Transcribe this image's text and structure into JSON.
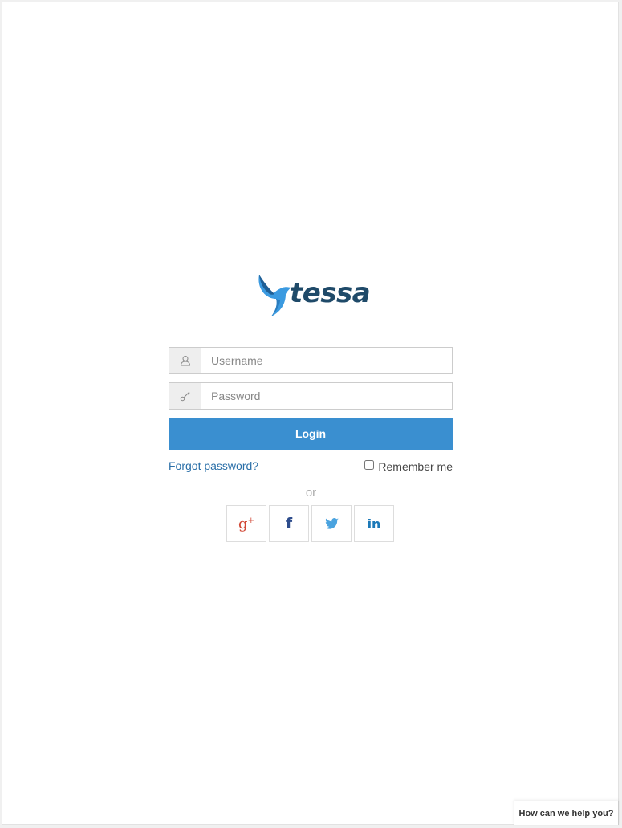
{
  "brand": {
    "name": "tessa"
  },
  "login_form": {
    "username": {
      "placeholder": "Username",
      "value": ""
    },
    "password": {
      "placeholder": "Password",
      "value": ""
    },
    "login_label": "Login",
    "forgot_label": "Forgot password?",
    "remember_label": "Remember me",
    "remember_checked": false
  },
  "divider_text": "or",
  "social": [
    {
      "network": "google-plus",
      "glyph": "g+"
    },
    {
      "network": "facebook",
      "glyph": "f"
    },
    {
      "network": "twitter",
      "glyph": "twitter-bird"
    },
    {
      "network": "linkedin",
      "glyph": "in"
    }
  ],
  "help": {
    "label": "How can we help you?"
  },
  "colors": {
    "primary": "#3a8fd0",
    "link": "#2a6fa8",
    "brand_dark": "#1f4a69",
    "brand_light": "#3b9ae0",
    "google": "#d14836",
    "facebook": "#2d4c8c",
    "twitter": "#4aa3df",
    "linkedin": "#1c79b8"
  }
}
